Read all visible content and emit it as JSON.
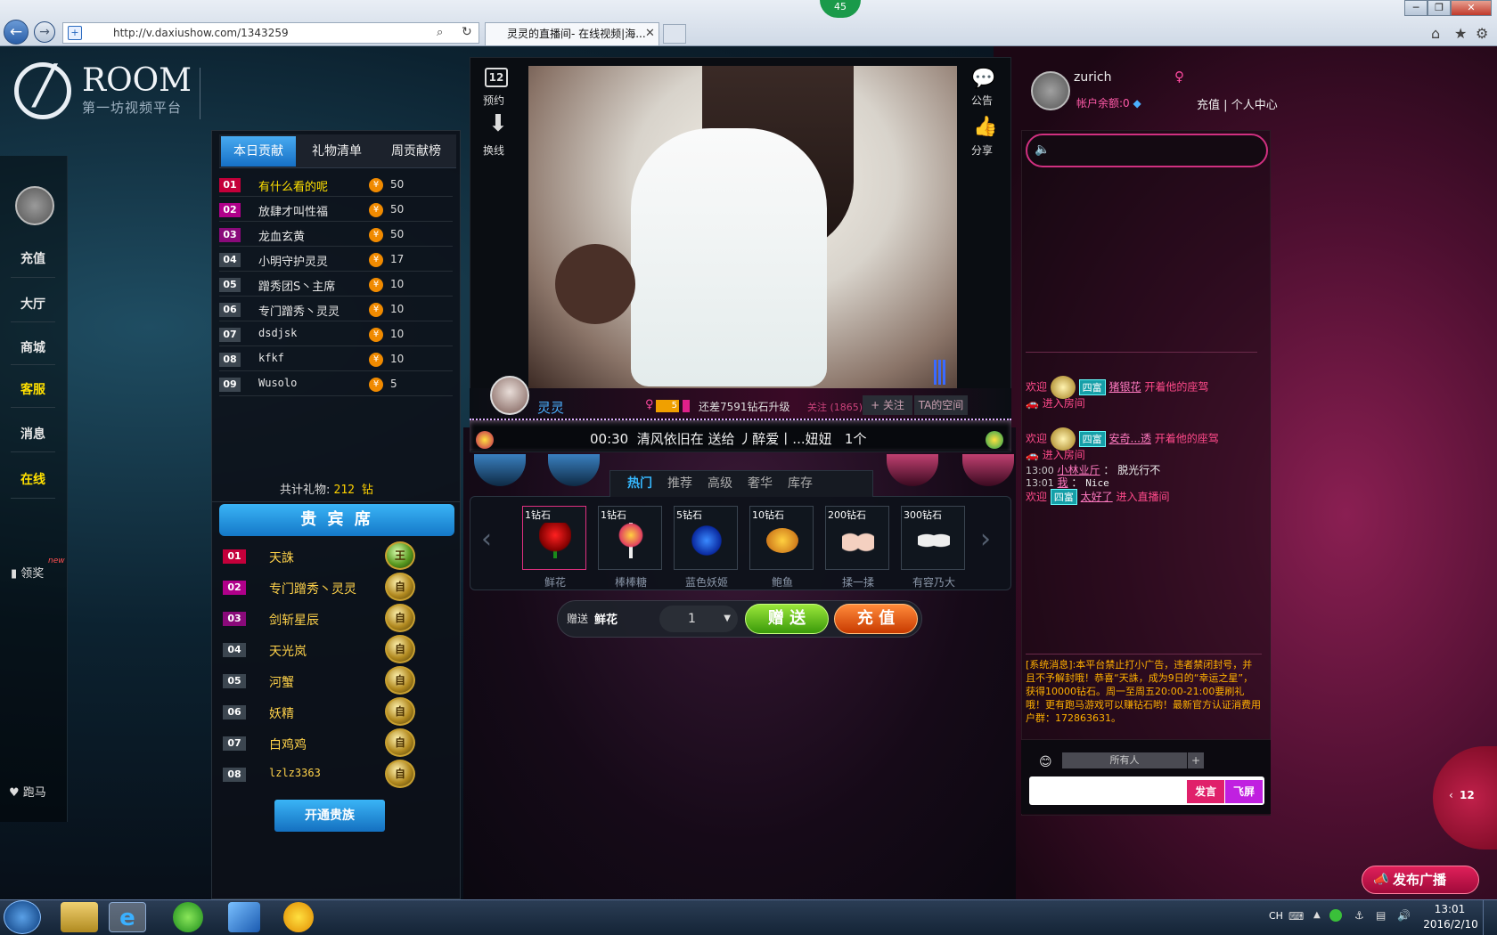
{
  "browser": {
    "url": "http://v.daxiushow.com/1343259",
    "tab_title": "灵灵的直播间- 在线视频|海...",
    "badge_count": "45"
  },
  "logo": {
    "brand": "ROOM",
    "subtitle": "第一坊视频平台"
  },
  "leftnav": {
    "items": [
      {
        "label": "充值",
        "highlight": false
      },
      {
        "label": "大厅",
        "highlight": false
      },
      {
        "label": "商城",
        "highlight": false
      },
      {
        "label": "客服",
        "highlight": true
      },
      {
        "label": "消息",
        "highlight": false
      },
      {
        "label": "在线",
        "highlight": true
      }
    ],
    "reward": "领奖",
    "reward_new": "new",
    "horse": "跑马"
  },
  "contrib": {
    "tabs": [
      "本日贡献",
      "礼物清单",
      "周贡献榜"
    ],
    "rows": [
      {
        "rank": "01",
        "name": "有什么看的呢",
        "value": "50",
        "name_color": "#ffe000"
      },
      {
        "rank": "02",
        "name": "放肆才叫性福",
        "value": "50"
      },
      {
        "rank": "03",
        "name": "龙血玄黄",
        "value": "50"
      },
      {
        "rank": "04",
        "name": "小明守护灵灵",
        "value": "17"
      },
      {
        "rank": "05",
        "name": "蹭秀团S丶主席",
        "value": "10"
      },
      {
        "rank": "06",
        "name": "专门蹭秀丶灵灵",
        "value": "10"
      },
      {
        "rank": "07",
        "name": "dsdjsk",
        "value": "10"
      },
      {
        "rank": "08",
        "name": "kfkf",
        "value": "10"
      },
      {
        "rank": "09",
        "name": "Wusolo",
        "value": "5"
      }
    ],
    "total_label": "共计礼物:",
    "total_value": "212 钻"
  },
  "vip": {
    "title": "贵 宾 席",
    "rows": [
      {
        "rank": "01",
        "name": "天誅",
        "badge": "王"
      },
      {
        "rank": "02",
        "name": "专门蹭秀丶灵灵",
        "badge": "自"
      },
      {
        "rank": "03",
        "name": "剑斩星辰",
        "badge": "自"
      },
      {
        "rank": "04",
        "name": "天光岚",
        "badge": "自"
      },
      {
        "rank": "05",
        "name": "河蟹",
        "badge": "自"
      },
      {
        "rank": "06",
        "name": "妖精",
        "badge": "自"
      },
      {
        "rank": "07",
        "name": "白鸡鸡",
        "badge": "自"
      },
      {
        "rank": "08",
        "name": "lzlz3363",
        "badge": "自"
      }
    ],
    "open_button": "开通贵族"
  },
  "stage": {
    "left_tools": [
      {
        "label": "预约",
        "icon": "calendar-icon",
        "num": "12"
      },
      {
        "label": "换线",
        "icon": "arrow-down-icon"
      }
    ],
    "right_tools": [
      {
        "label": "公告",
        "icon": "speech-bubble-icon"
      },
      {
        "label": "分享",
        "icon": "thumbs-up-icon"
      }
    ],
    "host_name": "灵灵",
    "host_level": "5",
    "upgrade_text": "还差7591钻石升级",
    "follow_count": "关注 (1865)",
    "follow_button": "+ 关注",
    "space_button": "TA的空间",
    "marquee": "00:30  清风依旧在 送给 丿醉爱丨...妞妞   1个"
  },
  "gifts": {
    "tabs": [
      "热门",
      "推荐",
      "高级",
      "奢华",
      "库存"
    ],
    "items": [
      {
        "price": "1钻石",
        "name": "鲜花",
        "icon": "rose-icon",
        "selected": true
      },
      {
        "price": "1钻石",
        "name": "棒棒糖",
        "icon": "lollipop-icon",
        "selected": false
      },
      {
        "price": "5钻石",
        "name": "蓝色妖姬",
        "icon": "blue-rose-icon",
        "selected": false
      },
      {
        "price": "10钻石",
        "name": "鲍鱼",
        "icon": "abalone-icon",
        "selected": false
      },
      {
        "price": "200钻石",
        "name": "揉一揉",
        "icon": "hands-icon",
        "selected": false
      },
      {
        "price": "300钻石",
        "name": "有容乃大",
        "icon": "bra-icon",
        "selected": false
      }
    ],
    "send_label": "赠送",
    "send_gift": "鲜花",
    "quantity": "1",
    "give_button": "赠 送",
    "recharge_button": "充 值"
  },
  "user": {
    "name": "zurich",
    "balance": "帐户余额:0",
    "recharge": "充值",
    "separator": "|",
    "center": "个人中心"
  },
  "chat": {
    "messages": [
      {
        "prefix": "欢迎",
        "tag": "四富",
        "name": "猪银花",
        "text": "开着他的座驾",
        "sub": "进入房间"
      },
      {
        "prefix": "欢迎",
        "tag": "四富",
        "name": "安奇...透",
        "text": "开着他的座驾",
        "sub": "进入房间"
      }
    ],
    "lines": [
      {
        "time": "13:00",
        "name": "小林业斤",
        "text": "脱光行不"
      },
      {
        "time": "13:01",
        "name": "我",
        "text": "Nice"
      }
    ],
    "welcome3": {
      "prefix": "欢迎",
      "tag": "四富",
      "name": "太好了",
      "text": "进入直播间"
    },
    "system_msg": "[系统消息]:本平台禁止打小广告，违者禁闭封号，并且不予解封哦！恭喜“天誅，成为9日的“幸运之星”，获得10000钻石。周一至周五20:00-21:00要刷礼哦！更有跑马游戏可以赚钻石哟！最新官方认证消费用户群：172863631。",
    "recipient": "所有人",
    "send_button": "发言",
    "fly_button": "飞屏",
    "side_count": "12",
    "broadcast_button": "发布广播"
  },
  "taskbar": {
    "lang": "CH",
    "time": "13:01",
    "date": "2016/2/10"
  }
}
